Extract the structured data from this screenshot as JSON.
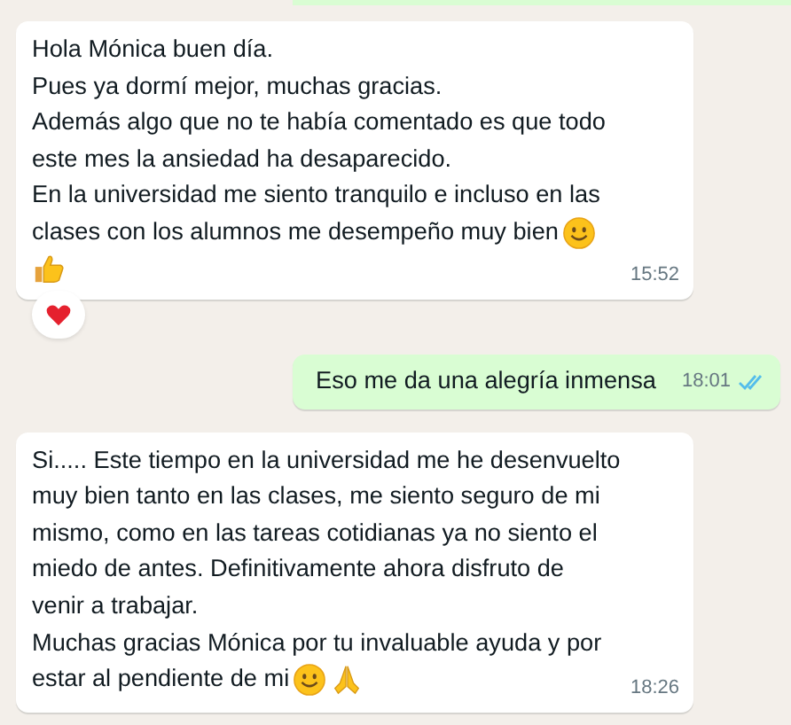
{
  "messages": [
    {
      "outgoing": false,
      "lines": [
        [
          {
            "kind": "text",
            "text": "Hola Mónica buen día."
          }
        ],
        [
          {
            "kind": "text",
            "text": "Pues ya dormí mejor, muchas gracias."
          }
        ],
        [
          {
            "kind": "text",
            "text": "Además algo que no te había comentado es que todo"
          }
        ],
        [
          {
            "kind": "text",
            "text": "este mes la ansiedad ha desaparecido."
          }
        ],
        [
          {
            "kind": "text",
            "text": "En la universidad me siento tranquilo e incluso en las"
          }
        ],
        [
          {
            "kind": "text",
            "text": "clases con los alumnos me desempeño muy bien"
          },
          {
            "kind": "smile"
          }
        ],
        [
          {
            "kind": "thumbs-up"
          }
        ]
      ],
      "time": "15:52",
      "reaction": {
        "kind": "heart"
      }
    },
    {
      "outgoing": true,
      "lines": [
        [
          {
            "kind": "text",
            "text": "Eso me da una alegría inmensa"
          }
        ]
      ],
      "time": "18:01",
      "read": true
    },
    {
      "outgoing": false,
      "lines": [
        [
          {
            "kind": "text",
            "text": "Si..... Este tiempo en la universidad me he desenvuelto"
          }
        ],
        [
          {
            "kind": "text",
            "text": "muy bien tanto en las clases, me siento seguro de mi"
          }
        ],
        [
          {
            "kind": "text",
            "text": "mismo, como en las tareas cotidianas ya no siento el"
          }
        ],
        [
          {
            "kind": "text",
            "text": "miedo de antes. Definitivamente ahora disfruto de"
          }
        ],
        [
          {
            "kind": "text",
            "text": "venir a trabajar."
          }
        ],
        [
          {
            "kind": "text",
            "text": "Muchas gracias Mónica por tu invaluable ayuda y por"
          }
        ],
        [
          {
            "kind": "text",
            "text": "estar al pendiente de mi"
          },
          {
            "kind": "smile"
          },
          {
            "kind": "pray"
          }
        ]
      ],
      "time": "18:26"
    }
  ]
}
